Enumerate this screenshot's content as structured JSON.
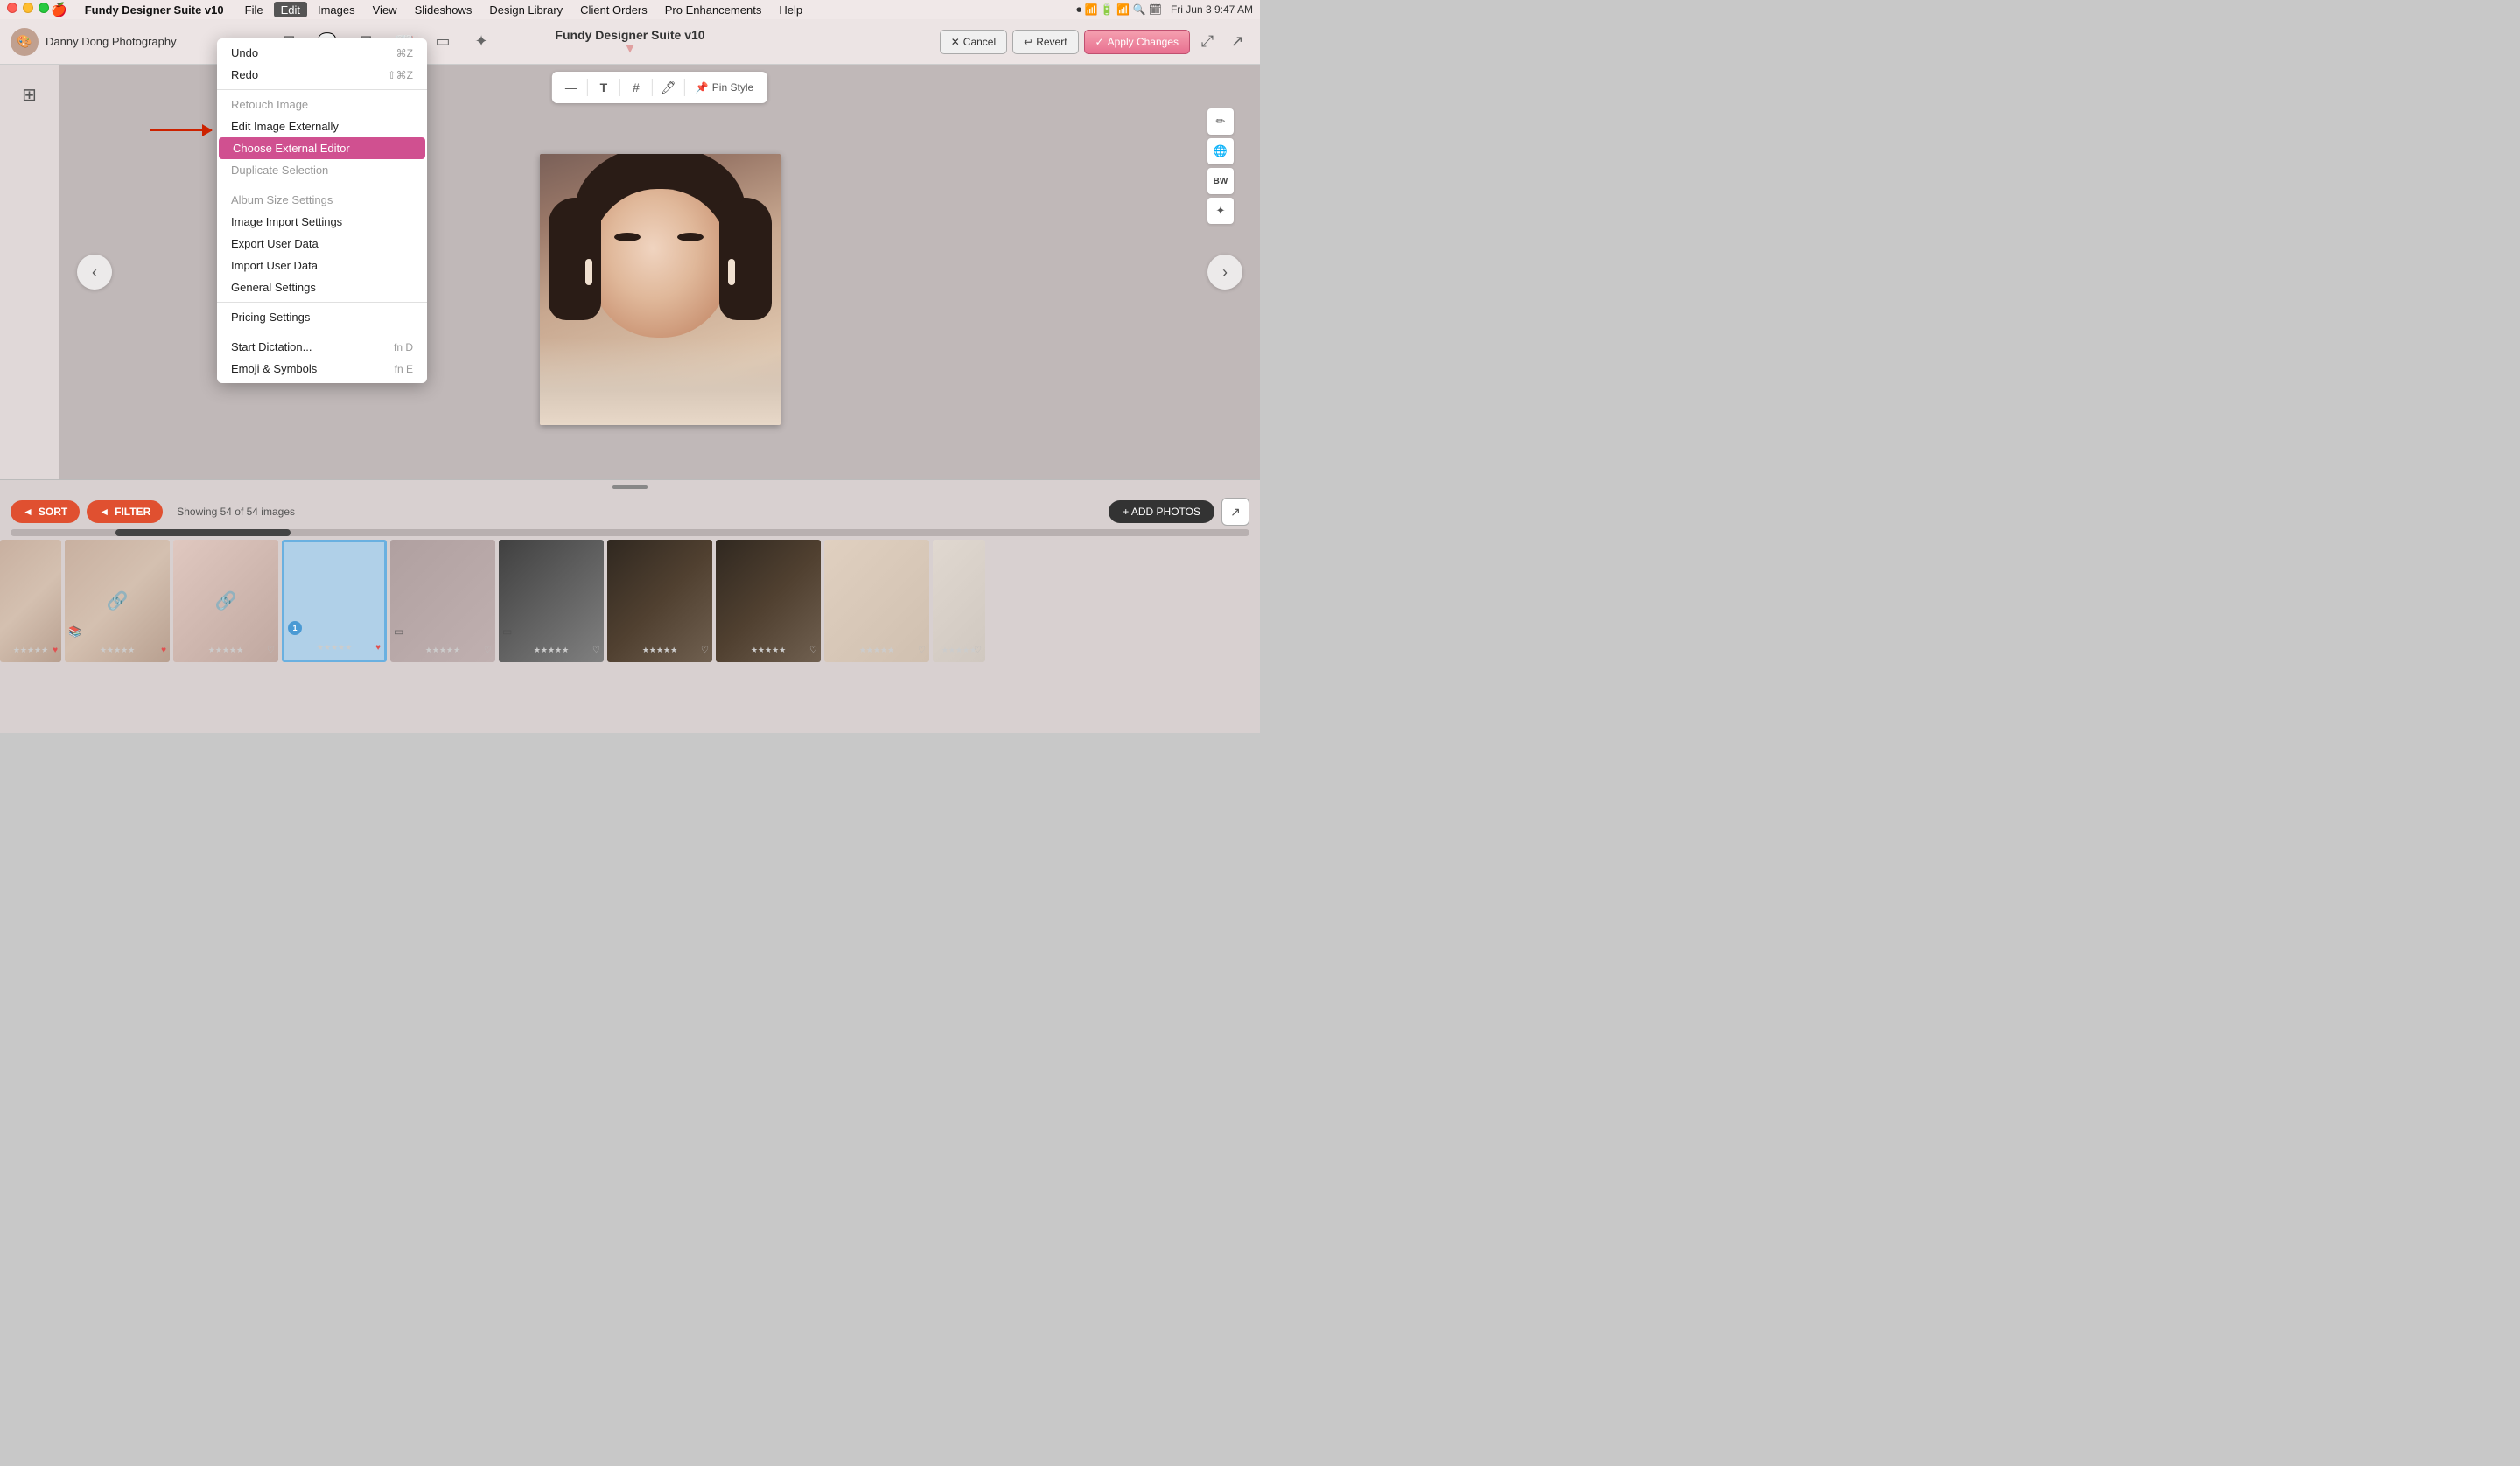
{
  "app": {
    "name": "Fundy Designer Suite v10",
    "window_title": "Fundy Designer Suite v10"
  },
  "menubar": {
    "apple": "🍎",
    "items": [
      {
        "label": "Fundy Designer Suite v10",
        "active": false
      },
      {
        "label": "File",
        "active": false
      },
      {
        "label": "Edit",
        "active": true
      },
      {
        "label": "Images",
        "active": false
      },
      {
        "label": "View",
        "active": false
      },
      {
        "label": "Slideshows",
        "active": false
      },
      {
        "label": "Design Library",
        "active": false
      },
      {
        "label": "Client Orders",
        "active": false
      },
      {
        "label": "Pro Enhancements",
        "active": false
      },
      {
        "label": "Help",
        "active": false
      }
    ],
    "right": {
      "datetime": "Fri Jun 3  9:47 AM"
    }
  },
  "toolbar": {
    "title": "Fundy Designer Suite v10",
    "cancel_label": "Cancel",
    "revert_label": "Revert",
    "apply_label": "Apply Changes"
  },
  "sidebar": {
    "studio_label": "Danny Dong Photography"
  },
  "image_tools": {
    "minus_label": "—",
    "text_label": "T",
    "hash_label": "#",
    "eyedropper_label": "🖊",
    "pin_style_label": "Pin Style"
  },
  "main_image": {
    "alt": "Portrait photo of woman"
  },
  "navigation": {
    "prev_label": "‹",
    "next_label": "›"
  },
  "dropdown_menu": {
    "items": [
      {
        "label": "Undo",
        "shortcut": "⌘Z",
        "disabled": false,
        "active": false,
        "separator_after": false
      },
      {
        "label": "Redo",
        "shortcut": "⇧⌘Z",
        "disabled": false,
        "active": false,
        "separator_after": true
      },
      {
        "label": "Retouch Image",
        "shortcut": "",
        "disabled": true,
        "active": false,
        "separator_after": false
      },
      {
        "label": "Edit Image Externally",
        "shortcut": "",
        "disabled": false,
        "active": false,
        "separator_after": false
      },
      {
        "label": "Choose External Editor",
        "shortcut": "",
        "disabled": false,
        "active": true,
        "separator_after": false
      },
      {
        "label": "Duplicate Selection",
        "shortcut": "",
        "disabled": true,
        "active": false,
        "separator_after": true
      },
      {
        "label": "Album Size Settings",
        "shortcut": "",
        "disabled": true,
        "active": false,
        "separator_after": false
      },
      {
        "label": "Image Import Settings",
        "shortcut": "",
        "disabled": false,
        "active": false,
        "separator_after": false
      },
      {
        "label": "Export User Data",
        "shortcut": "",
        "disabled": false,
        "active": false,
        "separator_after": false
      },
      {
        "label": "Import User Data",
        "shortcut": "",
        "disabled": false,
        "active": false,
        "separator_after": false
      },
      {
        "label": "General Settings",
        "shortcut": "",
        "disabled": false,
        "active": false,
        "separator_after": true
      },
      {
        "label": "Pricing Settings",
        "shortcut": "",
        "disabled": false,
        "active": false,
        "separator_after": true
      },
      {
        "label": "Start Dictation...",
        "shortcut": "fn D",
        "disabled": false,
        "active": false,
        "separator_after": false
      },
      {
        "label": "Emoji & Symbols",
        "shortcut": "fn E",
        "disabled": false,
        "active": false,
        "separator_after": false
      }
    ]
  },
  "bottom_panel": {
    "sort_label": "SORT",
    "filter_label": "FILTER",
    "showing_text": "Showing 54 of 54 images",
    "add_photos_label": "+ ADD PHOTOS"
  },
  "thumbnails": [
    {
      "id": 1,
      "style": "t1",
      "selected": false,
      "link": true,
      "heart": true,
      "book": true,
      "badge": null,
      "stars": 0
    },
    {
      "id": 2,
      "style": "t2",
      "selected": false,
      "link": true,
      "heart": false,
      "book": false,
      "badge": null,
      "stars": 0
    },
    {
      "id": 3,
      "style": "t3",
      "selected": false,
      "link": true,
      "heart": false,
      "book": false,
      "badge": null,
      "stars": 0
    },
    {
      "id": 4,
      "style": "t4",
      "selected": true,
      "link": false,
      "heart": true,
      "book": false,
      "badge": 1,
      "stars": 0
    },
    {
      "id": 5,
      "style": "t5",
      "selected": false,
      "link": false,
      "heart": false,
      "book": false,
      "badge": null,
      "stars": 0
    },
    {
      "id": 6,
      "style": "t6",
      "selected": false,
      "link": false,
      "heart": false,
      "book": false,
      "badge": null,
      "stars": 0
    },
    {
      "id": 7,
      "style": "t7",
      "selected": false,
      "link": false,
      "heart": false,
      "book": false,
      "badge": null,
      "stars": 0
    },
    {
      "id": 8,
      "style": "t8",
      "selected": false,
      "link": false,
      "heart": false,
      "book": false,
      "badge": null,
      "stars": 0
    },
    {
      "id": 9,
      "style": "t9",
      "selected": false,
      "link": false,
      "heart": false,
      "book": false,
      "badge": null,
      "stars": 0
    }
  ]
}
